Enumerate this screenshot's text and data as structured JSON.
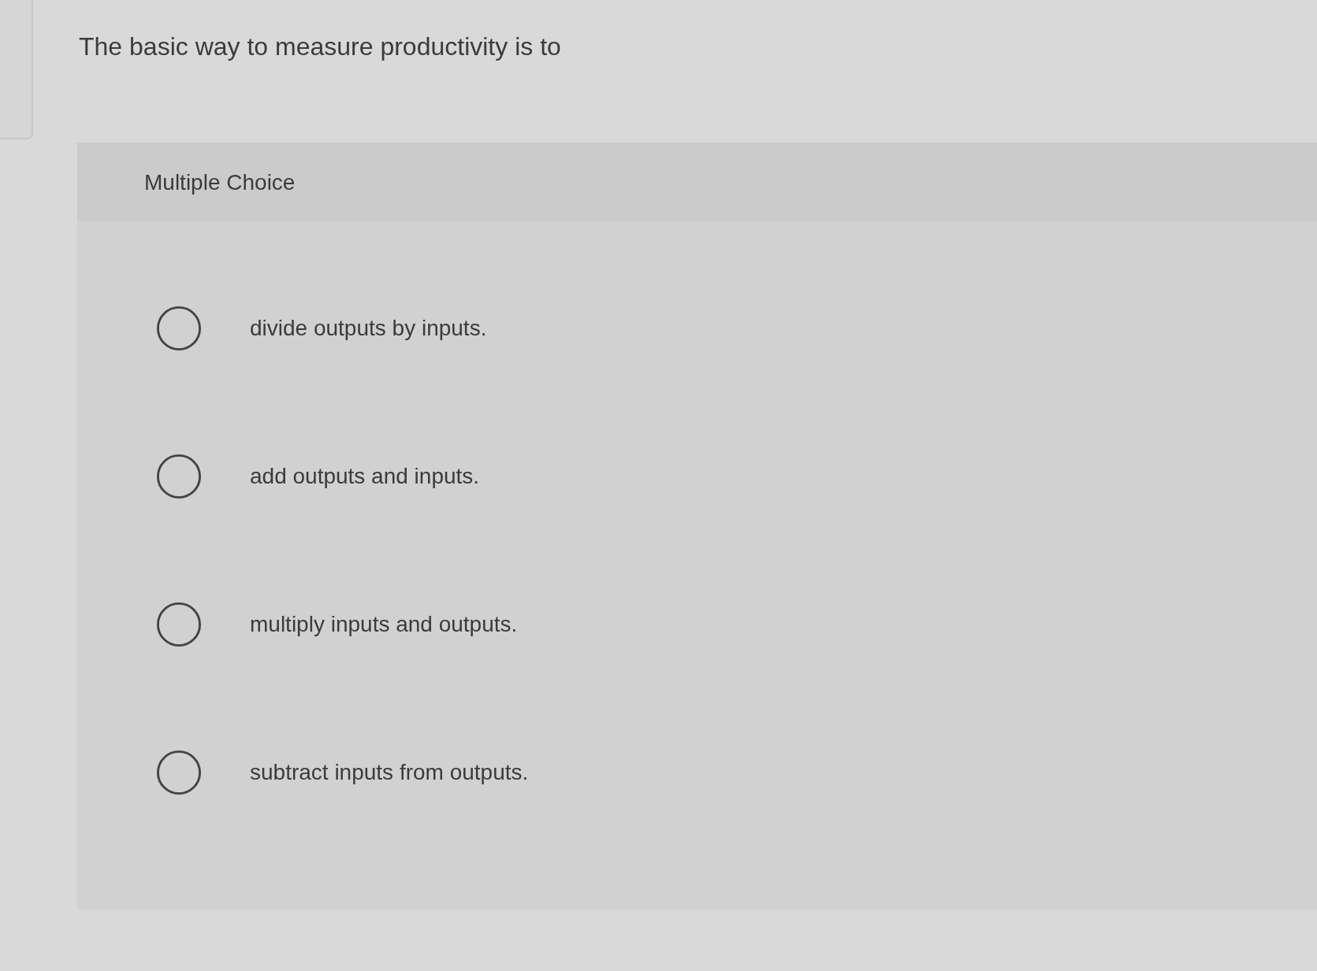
{
  "question": {
    "text": "The basic way to measure productivity is to"
  },
  "answer_panel": {
    "heading": "Multiple Choice",
    "options": [
      {
        "text": "divide outputs by inputs.",
        "selected": false
      },
      {
        "text": "add outputs and inputs.",
        "selected": false
      },
      {
        "text": "multiply inputs and outputs.",
        "selected": false
      },
      {
        "text": "subtract inputs from outputs.",
        "selected": false
      }
    ]
  }
}
